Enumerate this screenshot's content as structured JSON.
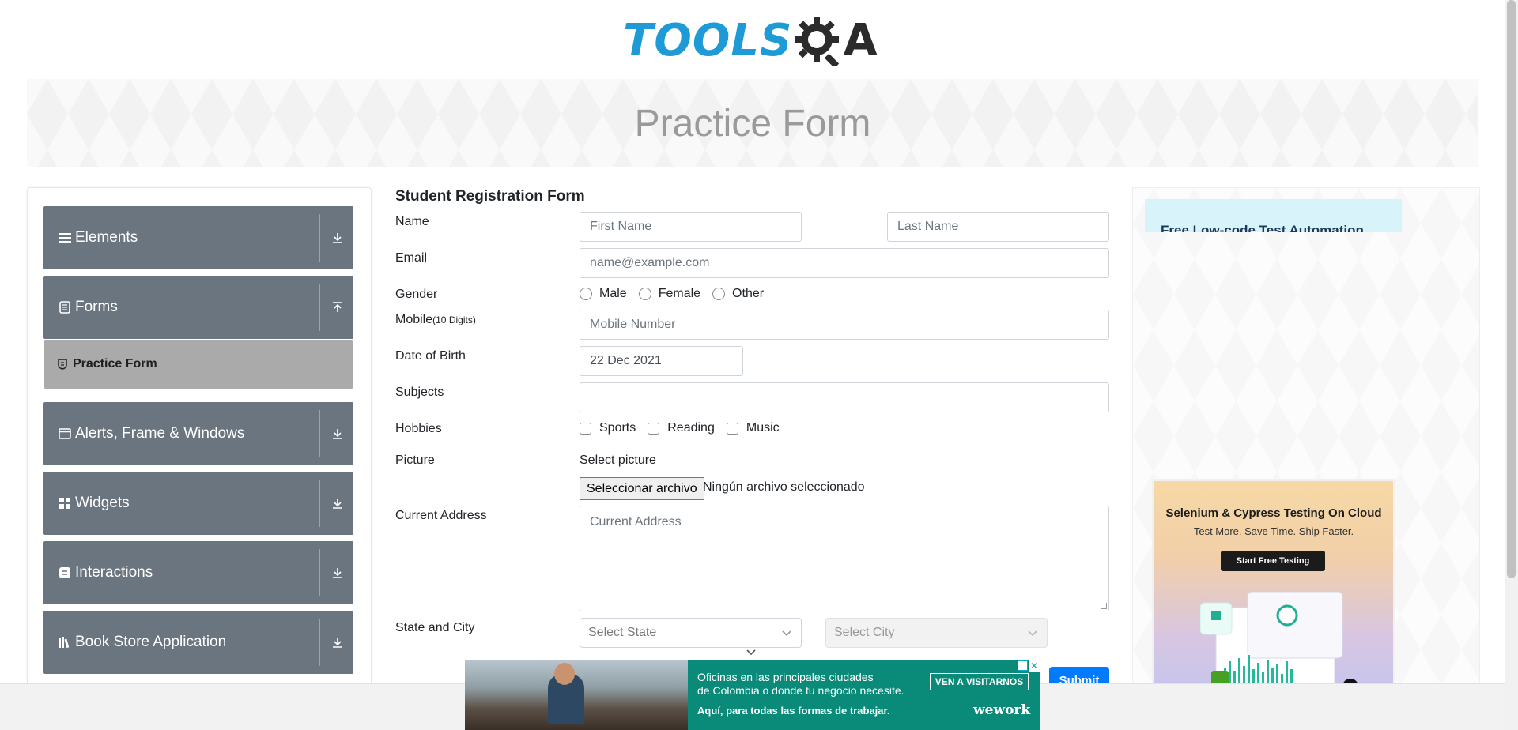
{
  "header": {
    "logo_text": "TOOLS",
    "logo_letter": "A"
  },
  "banner": {
    "title": "Practice Form"
  },
  "sidebar": {
    "groups": [
      {
        "label": "Elements",
        "icon": "menu-icon",
        "expanded": false
      },
      {
        "label": "Forms",
        "icon": "document-icon",
        "expanded": true
      },
      {
        "label": "Alerts, Frame & Windows",
        "icon": "window-icon",
        "expanded": false
      },
      {
        "label": "Widgets",
        "icon": "grid-icon",
        "expanded": false
      },
      {
        "label": "Interactions",
        "icon": "interaction-icon",
        "expanded": false
      },
      {
        "label": "Book Store Application",
        "icon": "books-icon",
        "expanded": false
      }
    ],
    "active_item": {
      "label": "Practice Form",
      "icon": "shield-icon"
    }
  },
  "form": {
    "title": "Student Registration Form",
    "labels": {
      "name": "Name",
      "email": "Email",
      "gender": "Gender",
      "mobile": "Mobile",
      "mobile_hint": "(10 Digits)",
      "dob": "Date of Birth",
      "subjects": "Subjects",
      "hobbies": "Hobbies",
      "picture": "Picture",
      "address": "Current Address",
      "state_city": "State and City"
    },
    "first_name_placeholder": "First Name",
    "last_name_placeholder": "Last Name",
    "email_placeholder": "name@example.com",
    "gender_options": [
      "Male",
      "Female",
      "Other"
    ],
    "mobile_placeholder": "Mobile Number",
    "dob_value": "22 Dec 2021",
    "subjects_value": "",
    "hobby_options": [
      "Sports",
      "Reading",
      "Music"
    ],
    "picture_label": "Select picture",
    "file_button": "Seleccionar archivo",
    "file_status": "Ningún archivo seleccionado",
    "address_placeholder": "Current Address",
    "state_placeholder": "Select State",
    "city_placeholder": "Select City",
    "submit_label": "Submit"
  },
  "ads": {
    "top_text": "Free Low-code Test Automation",
    "card_title": "Selenium & Cypress Testing On Cloud",
    "card_subtitle": "Test More. Save Time. Ship Faster.",
    "card_button": "Start Free Testing",
    "bottom_line1": "Oficinas en las principales ciudades",
    "bottom_line2": "de Colombia o donde tu negocio necesite.",
    "bottom_line3": "Aquí, para todas las formas de trabajar.",
    "bottom_cta": "VEN A VISITARNOS",
    "bottom_brand": "wework",
    "close_symbol": "✕"
  },
  "colors": {
    "accent": "#007bff",
    "sidebar_group": "#6b7580",
    "sidebar_active": "#aaaaaa",
    "logo_blue": "#1e9bd7",
    "ad_green": "#0a8b7a"
  }
}
